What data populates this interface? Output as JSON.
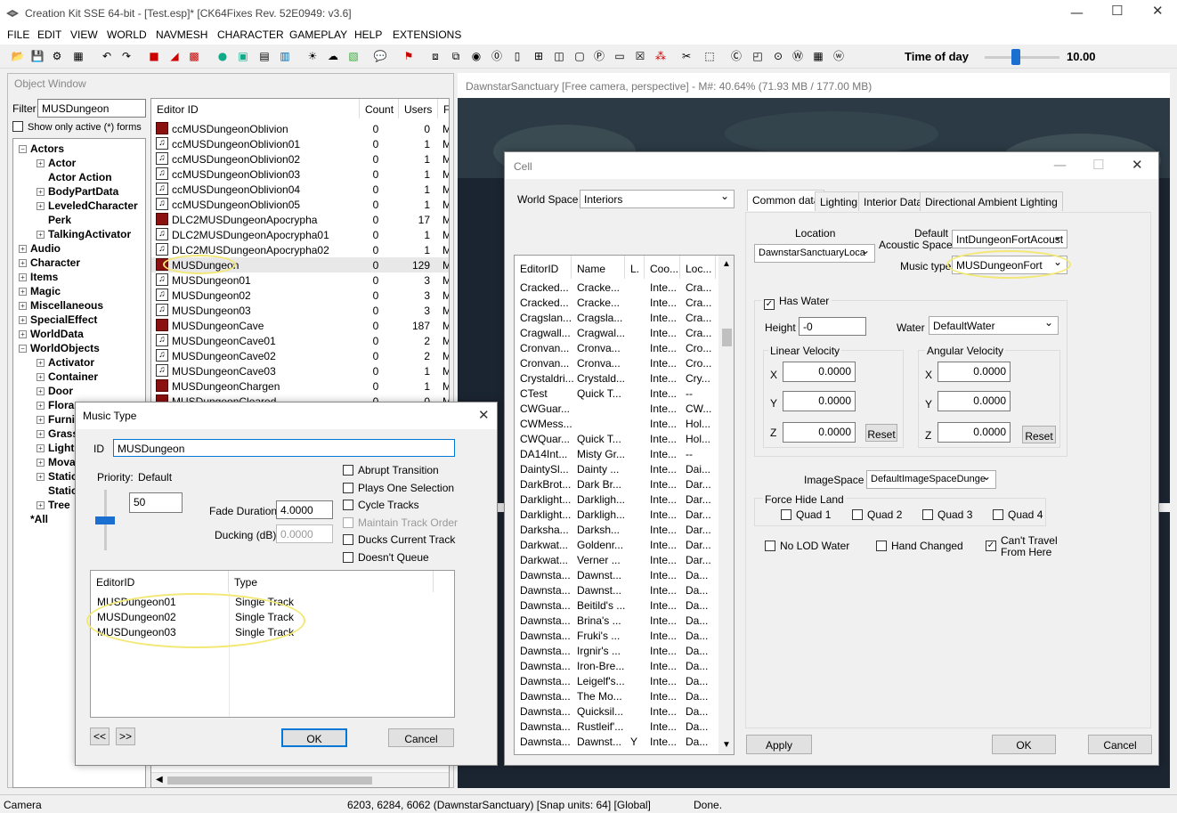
{
  "app": {
    "title": "Creation Kit SSE 64-bit - [Test.esp]* [CK64Fixes Rev. 52E0949: v3.6]"
  },
  "menu": [
    "FILE",
    "EDIT",
    "VIEW",
    "WORLD",
    "NAVMESH",
    "CHARACTER",
    "GAMEPLAY",
    "HELP",
    "EXTENSIONS"
  ],
  "toolbar": {
    "time_of_day_label": "Time of day",
    "time_of_day_value": "10.00",
    "time_of_day_fraction": 0.42
  },
  "object_window": {
    "title": "Object Window",
    "filter_label": "Filter",
    "filter_value": "MUSDungeon",
    "show_active_label": "Show only active (*) forms",
    "tree": [
      {
        "label": "Actors",
        "level": 0,
        "expander": "-"
      },
      {
        "label": "Actor",
        "level": 1,
        "expander": "+"
      },
      {
        "label": "Actor Action",
        "level": 1,
        "expander": ""
      },
      {
        "label": "BodyPartData",
        "level": 1,
        "expander": "+"
      },
      {
        "label": "LeveledCharacter",
        "level": 1,
        "expander": "+"
      },
      {
        "label": "Perk",
        "level": 1,
        "expander": ""
      },
      {
        "label": "TalkingActivator",
        "level": 1,
        "expander": "+"
      },
      {
        "label": "Audio",
        "level": 0,
        "expander": "+"
      },
      {
        "label": "Character",
        "level": 0,
        "expander": "+"
      },
      {
        "label": "Items",
        "level": 0,
        "expander": "+"
      },
      {
        "label": "Magic",
        "level": 0,
        "expander": "+"
      },
      {
        "label": "Miscellaneous",
        "level": 0,
        "expander": "+"
      },
      {
        "label": "SpecialEffect",
        "level": 0,
        "expander": "+"
      },
      {
        "label": "WorldData",
        "level": 0,
        "expander": "+"
      },
      {
        "label": "WorldObjects",
        "level": 0,
        "expander": "-"
      },
      {
        "label": "Activator",
        "level": 1,
        "expander": "+"
      },
      {
        "label": "Container",
        "level": 1,
        "expander": "+"
      },
      {
        "label": "Door",
        "level": 1,
        "expander": "+"
      },
      {
        "label": "Flora",
        "level": 1,
        "expander": "+"
      },
      {
        "label": "Furnit",
        "level": 1,
        "expander": "+"
      },
      {
        "label": "Grass",
        "level": 1,
        "expander": "+"
      },
      {
        "label": "Light",
        "level": 1,
        "expander": "+"
      },
      {
        "label": "Mova",
        "level": 1,
        "expander": "+"
      },
      {
        "label": "Static",
        "level": 1,
        "expander": "+"
      },
      {
        "label": "Static",
        "level": 1,
        "expander": ""
      },
      {
        "label": "Tree",
        "level": 1,
        "expander": "+"
      },
      {
        "label": "*All",
        "level": 0,
        "expander": ""
      }
    ],
    "columns": [
      "Editor ID",
      "Count",
      "Users",
      "Fi"
    ],
    "rows": [
      {
        "id": "ccMUSDungeonOblivion",
        "count": "0",
        "users": "0",
        "file": "M",
        "icon": "red"
      },
      {
        "id": "ccMUSDungeonOblivion01",
        "count": "0",
        "users": "1",
        "file": "M",
        "icon": "note"
      },
      {
        "id": "ccMUSDungeonOblivion02",
        "count": "0",
        "users": "1",
        "file": "M",
        "icon": "note"
      },
      {
        "id": "ccMUSDungeonOblivion03",
        "count": "0",
        "users": "1",
        "file": "M",
        "icon": "note"
      },
      {
        "id": "ccMUSDungeonOblivion04",
        "count": "0",
        "users": "1",
        "file": "M",
        "icon": "note"
      },
      {
        "id": "ccMUSDungeonOblivion05",
        "count": "0",
        "users": "1",
        "file": "M",
        "icon": "note"
      },
      {
        "id": "DLC2MUSDungeonApocrypha",
        "count": "0",
        "users": "17",
        "file": "M",
        "icon": "red"
      },
      {
        "id": "DLC2MUSDungeonApocrypha01",
        "count": "0",
        "users": "1",
        "file": "M",
        "icon": "note"
      },
      {
        "id": "DLC2MUSDungeonApocrypha02",
        "count": "0",
        "users": "1",
        "file": "M",
        "icon": "note"
      },
      {
        "id": "MUSDungeon",
        "count": "0",
        "users": "129",
        "file": "M",
        "icon": "red"
      },
      {
        "id": "MUSDungeon01",
        "count": "0",
        "users": "3",
        "file": "M",
        "icon": "note"
      },
      {
        "id": "MUSDungeon02",
        "count": "0",
        "users": "3",
        "file": "M",
        "icon": "note"
      },
      {
        "id": "MUSDungeon03",
        "count": "0",
        "users": "3",
        "file": "M",
        "icon": "note"
      },
      {
        "id": "MUSDungeonCave",
        "count": "0",
        "users": "187",
        "file": "M",
        "icon": "red"
      },
      {
        "id": "MUSDungeonCave01",
        "count": "0",
        "users": "2",
        "file": "M",
        "icon": "note"
      },
      {
        "id": "MUSDungeonCave02",
        "count": "0",
        "users": "2",
        "file": "M",
        "icon": "note"
      },
      {
        "id": "MUSDungeonCave03",
        "count": "0",
        "users": "1",
        "file": "M",
        "icon": "note"
      },
      {
        "id": "MUSDungeonChargen",
        "count": "0",
        "users": "1",
        "file": "M",
        "icon": "red"
      },
      {
        "id": "MUSDungeonCleared",
        "count": "0",
        "users": "0",
        "file": "M",
        "icon": "red"
      }
    ]
  },
  "viewport": {
    "title": "DawnstarSanctuary [Free camera, perspective] - M#: 40.64% (71.93 MB / 177.00 MB)"
  },
  "music_type": {
    "title": "Music Type",
    "id_label": "ID",
    "id_value": "MUSDungeon",
    "priority_label": "Priority:",
    "priority_default": "Default",
    "priority_value": "50",
    "fade_label": "Fade Duration:",
    "fade_value": "4.0000",
    "ducking_label": "Ducking (dB):",
    "ducking_value": "0.0000",
    "checks": [
      {
        "label": "Abrupt Transition",
        "checked": false,
        "disabled": false
      },
      {
        "label": "Plays One Selection",
        "checked": false,
        "disabled": false
      },
      {
        "label": "Cycle Tracks",
        "checked": false,
        "disabled": false
      },
      {
        "label": "Maintain Track Order",
        "checked": false,
        "disabled": true
      },
      {
        "label": "Ducks Current Track",
        "checked": false,
        "disabled": false
      },
      {
        "label": "Doesn't Queue",
        "checked": false,
        "disabled": false
      }
    ],
    "track_columns": [
      "EditorID",
      "Type"
    ],
    "tracks": [
      {
        "id": "MUSDungeon01",
        "type": "Single Track"
      },
      {
        "id": "MUSDungeon02",
        "type": "Single Track"
      },
      {
        "id": "MUSDungeon03",
        "type": "Single Track"
      }
    ],
    "prev_label": "<<",
    "next_label": ">>",
    "ok_label": "OK",
    "cancel_label": "Cancel"
  },
  "cell": {
    "title": "Cell",
    "worldspace_label": "World Space",
    "worldspace_value": "Interiors",
    "list_columns": [
      "EditorID",
      "Name",
      "L.",
      "Coo...",
      "Loc..."
    ],
    "list_rows": [
      [
        "Cracked...",
        "Cracke...",
        "",
        "Inte...",
        "Cra..."
      ],
      [
        "Cracked...",
        "Cracke...",
        "",
        "Inte...",
        "Cra..."
      ],
      [
        "Cragslan...",
        "Cragsla...",
        "",
        "Inte...",
        "Cra..."
      ],
      [
        "Cragwall...",
        "Cragwal...",
        "",
        "Inte...",
        "Cra..."
      ],
      [
        "Cronvan...",
        "Cronva...",
        "",
        "Inte...",
        "Cro..."
      ],
      [
        "Cronvan...",
        "Cronva...",
        "",
        "Inte...",
        "Cro..."
      ],
      [
        "Crystaldri...",
        "Crystald...",
        "",
        "Inte...",
        "Cry..."
      ],
      [
        "CTest",
        "Quick T...",
        "",
        "Inte...",
        "--"
      ],
      [
        "CWGuar...",
        "",
        "",
        "Inte...",
        "CW..."
      ],
      [
        "CWMess...",
        "",
        "",
        "Inte...",
        "Hol..."
      ],
      [
        "CWQuar...",
        "Quick T...",
        "",
        "Inte...",
        "Hol..."
      ],
      [
        "DA14Int...",
        "Misty Gr...",
        "",
        "Inte...",
        "--"
      ],
      [
        "DaintySl...",
        "Dainty ...",
        "",
        "Inte...",
        "Dai..."
      ],
      [
        "DarkBrot...",
        "Dark Br...",
        "",
        "Inte...",
        "Dar..."
      ],
      [
        "Darklight...",
        "Darkligh...",
        "",
        "Inte...",
        "Dar..."
      ],
      [
        "Darklight...",
        "Darkligh...",
        "",
        "Inte...",
        "Dar..."
      ],
      [
        "Darksha...",
        "Darksh...",
        "",
        "Inte...",
        "Dar..."
      ],
      [
        "Darkwat...",
        "Goldenr...",
        "",
        "Inte...",
        "Dar..."
      ],
      [
        "Darkwat...",
        "Verner ...",
        "",
        "Inte...",
        "Dar..."
      ],
      [
        "Dawnsta...",
        "Dawnst...",
        "",
        "Inte...",
        "Da..."
      ],
      [
        "Dawnsta...",
        "Dawnst...",
        "",
        "Inte...",
        "Da..."
      ],
      [
        "Dawnsta...",
        "Beitild's ...",
        "",
        "Inte...",
        "Da..."
      ],
      [
        "Dawnsta...",
        "Brina's ...",
        "",
        "Inte...",
        "Da..."
      ],
      [
        "Dawnsta...",
        "Fruki's ...",
        "",
        "Inte...",
        "Da..."
      ],
      [
        "Dawnsta...",
        "Irgnir's ...",
        "",
        "Inte...",
        "Da..."
      ],
      [
        "Dawnsta...",
        "Iron-Bre...",
        "",
        "Inte...",
        "Da..."
      ],
      [
        "Dawnsta...",
        "Leigelf's...",
        "",
        "Inte...",
        "Da..."
      ],
      [
        "Dawnsta...",
        "The Mo...",
        "",
        "Inte...",
        "Da..."
      ],
      [
        "Dawnsta...",
        "Quicksil...",
        "",
        "Inte...",
        "Da..."
      ],
      [
        "Dawnsta...",
        "Rustleif'...",
        "",
        "Inte...",
        "Da..."
      ],
      [
        "Dawnsta...",
        "Dawnst...",
        "Y",
        "Inte...",
        "Da..."
      ]
    ],
    "tabs": [
      "Common data",
      "Lighting",
      "Interior Data",
      "Directional Ambient Lighting"
    ],
    "location_label": "Location",
    "location_value": "DawnstarSanctuaryLoca",
    "acoustic_label": "Default\nAcoustic Space",
    "acoustic_value": "IntDungeonFortAcoust",
    "music_label": "Music type",
    "music_value": "MUSDungeonFort",
    "has_water_label": "Has Water",
    "height_label": "Height",
    "height_value": "-0",
    "water_label": "Water",
    "water_value": "DefaultWater",
    "linear_label": "Linear Velocity",
    "angular_label": "Angular Velocity",
    "x_label": "X",
    "y_label": "Y",
    "z_label": "Z",
    "lin_x": "0.0000",
    "lin_y": "0.0000",
    "lin_z": "0.0000",
    "ang_x": "0.0000",
    "ang_y": "0.0000",
    "ang_z": "0.0000",
    "reset_label": "Reset",
    "imagespace_label": "ImageSpace",
    "imagespace_value": "DefaultImageSpaceDunge",
    "force_hide_label": "Force Hide Land",
    "quads": [
      "Quad 1",
      "Quad 2",
      "Quad 3",
      "Quad 4"
    ],
    "no_lod_label": "No LOD Water",
    "hand_changed_label": "Hand Changed",
    "cant_travel_label": "Can't Travel\nFrom Here",
    "apply_label": "Apply",
    "ok_label": "OK",
    "cancel_label": "Cancel"
  },
  "status": {
    "left": "Camera",
    "middle": "6203, 6284, 6062 (DawnstarSanctuary) [Snap units: 64] [Global]",
    "right": "Done."
  }
}
